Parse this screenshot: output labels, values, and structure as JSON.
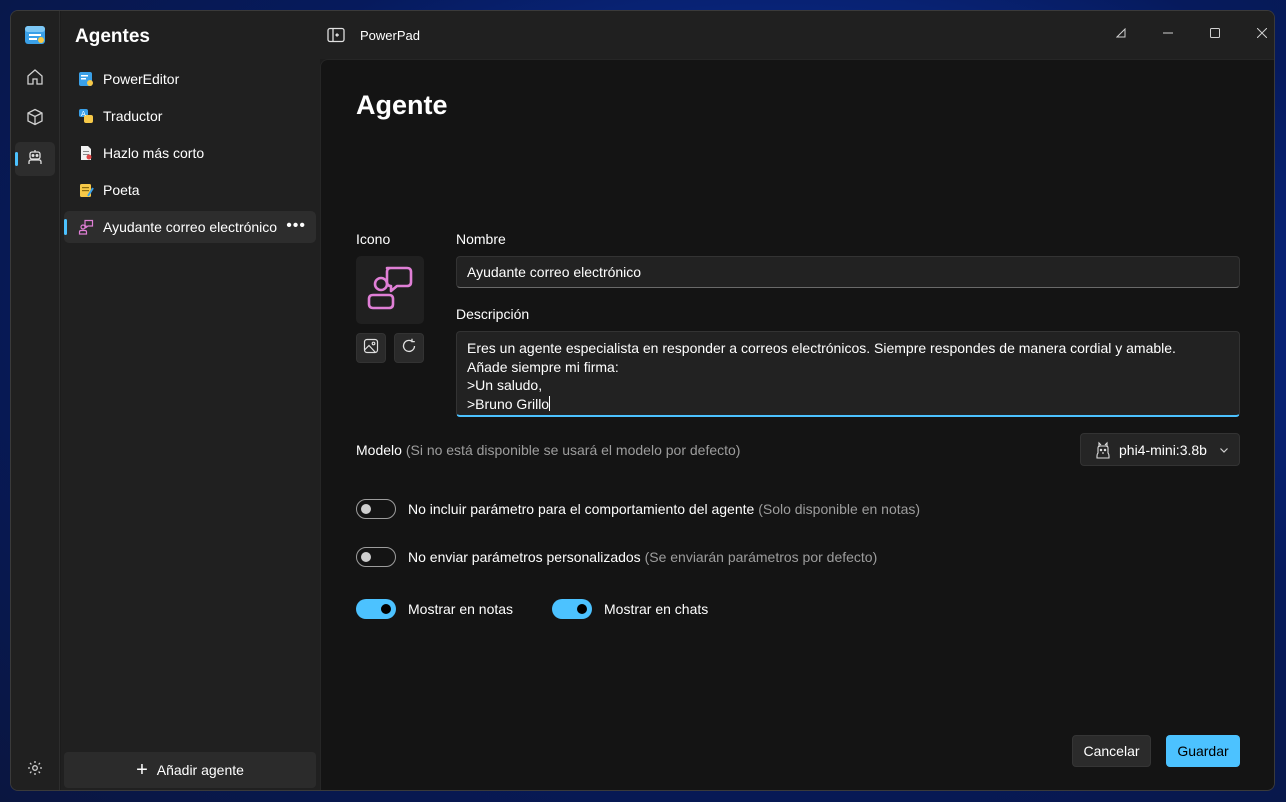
{
  "app": {
    "title": "PowerPad"
  },
  "sidebar": {
    "title": "Agentes",
    "items": [
      {
        "label": "PowerEditor",
        "icon": "editor-icon"
      },
      {
        "label": "Traductor",
        "icon": "translate-icon"
      },
      {
        "label": "Hazlo más corto",
        "icon": "document-icon"
      },
      {
        "label": "Poeta",
        "icon": "notepad-icon"
      },
      {
        "label": "Ayudante correo electrónico",
        "icon": "person-chat-icon",
        "more": "•••"
      }
    ],
    "add_label": "Añadir agente"
  },
  "main": {
    "page_title": "Agente",
    "icon_label": "Icono",
    "name_label": "Nombre",
    "name_value": "Ayudante correo electrónico",
    "description_label": "Descripción",
    "description_value": "Eres un agente especialista en responder a correos electrónicos. Siempre respondes de manera cordial y amable.\nAñade siempre mi firma:\n>Un saludo,\n>Bruno Grillo",
    "model_label": "Modelo",
    "model_hint": "(Si no está disponible se usará el modelo por defecto)",
    "model_value": "phi4-mini:3.8b",
    "toggles": [
      {
        "label": "No incluir parámetro para el comportamiento del agente",
        "hint": "(Solo disponible en notas)",
        "on": false
      },
      {
        "label": "No enviar parámetros personalizados",
        "hint": "(Se enviarán parámetros por defecto)",
        "on": false
      },
      {
        "label": "Mostrar en notas",
        "hint": "",
        "on": true
      },
      {
        "label": "Mostrar en chats",
        "hint": "",
        "on": true
      }
    ],
    "cancel_label": "Cancelar",
    "save_label": "Guardar"
  },
  "colors": {
    "accent": "#4cc2ff",
    "icon_pink": "#e07fd6"
  }
}
